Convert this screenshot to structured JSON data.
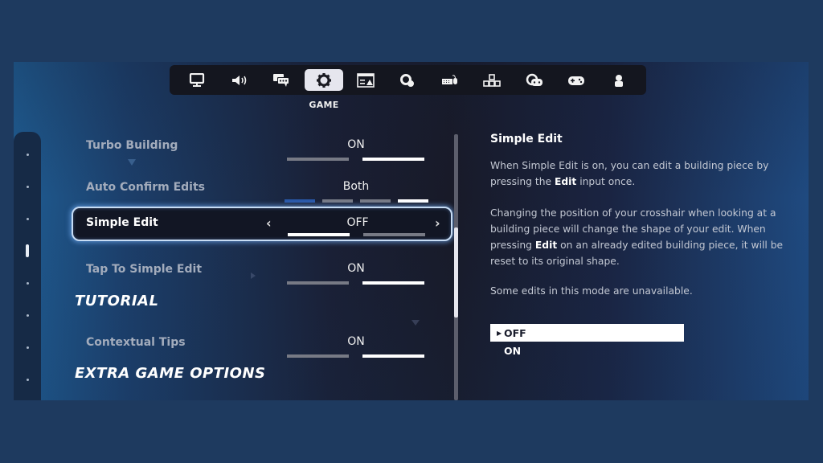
{
  "tabs": [
    {
      "name": "display",
      "icon": "monitor-icon"
    },
    {
      "name": "audio",
      "icon": "speaker-icon"
    },
    {
      "name": "accessibility",
      "icon": "chat-bubbles-icon"
    },
    {
      "name": "game",
      "icon": "gear-icon",
      "active": true
    },
    {
      "name": "hud",
      "icon": "hud-window-icon"
    },
    {
      "name": "touch",
      "icon": "gear-touch-icon"
    },
    {
      "name": "keyboard-mouse",
      "icon": "keyboard-mouse-icon"
    },
    {
      "name": "keybinds",
      "icon": "key-grid-icon"
    },
    {
      "name": "controller-options",
      "icon": "gear-controller-icon"
    },
    {
      "name": "controller",
      "icon": "controller-icon"
    },
    {
      "name": "account",
      "icon": "person-icon"
    }
  ],
  "active_tab_caption": "GAME",
  "settings": [
    {
      "label": "Turbo Building",
      "value": "ON",
      "options": 2,
      "selected": 1
    },
    {
      "label": "Auto Confirm Edits",
      "value": "Both",
      "options": 4,
      "selected": 3
    },
    {
      "label": "Simple Edit",
      "value": "OFF",
      "options": 2,
      "selected": 0,
      "focused": true
    },
    {
      "label": "Tap To Simple Edit",
      "value": "ON",
      "options": 2,
      "selected": 1
    },
    {
      "label": "Contextual Tips",
      "value": "ON",
      "options": 2,
      "selected": 1
    }
  ],
  "sections": {
    "tutorial": "TUTORIAL",
    "extra": "EXTRA GAME OPTIONS"
  },
  "arrows": {
    "left": "‹",
    "right": "›"
  },
  "scroll": {
    "position_fraction": 0.53,
    "thumb_fraction": 0.34
  },
  "rail": {
    "items": 8,
    "active_index": 3
  },
  "description": {
    "title": "Simple Edit",
    "p1_a": "When Simple Edit is on, you can edit a building piece by pressing the ",
    "p1_bold": "Edit",
    "p1_b": " input once.",
    "p2_a": "Changing the position of your crosshair when looking at a building piece will change the shape of your edit. When pressing ",
    "p2_bold": "Edit",
    "p2_b": " on an already edited building piece, it will be reset to its original shape.",
    "p3": "Some edits in this mode are unavailable.",
    "options": [
      "OFF",
      "ON"
    ],
    "selected_option": "OFF",
    "caret": "▶"
  },
  "colors": {
    "background": "#1e3a5f",
    "segment_on": "#ffffff",
    "segment_off": "#777a85",
    "segment_accent": "#2a58a8",
    "focus_glow": "#c7dcf4"
  }
}
